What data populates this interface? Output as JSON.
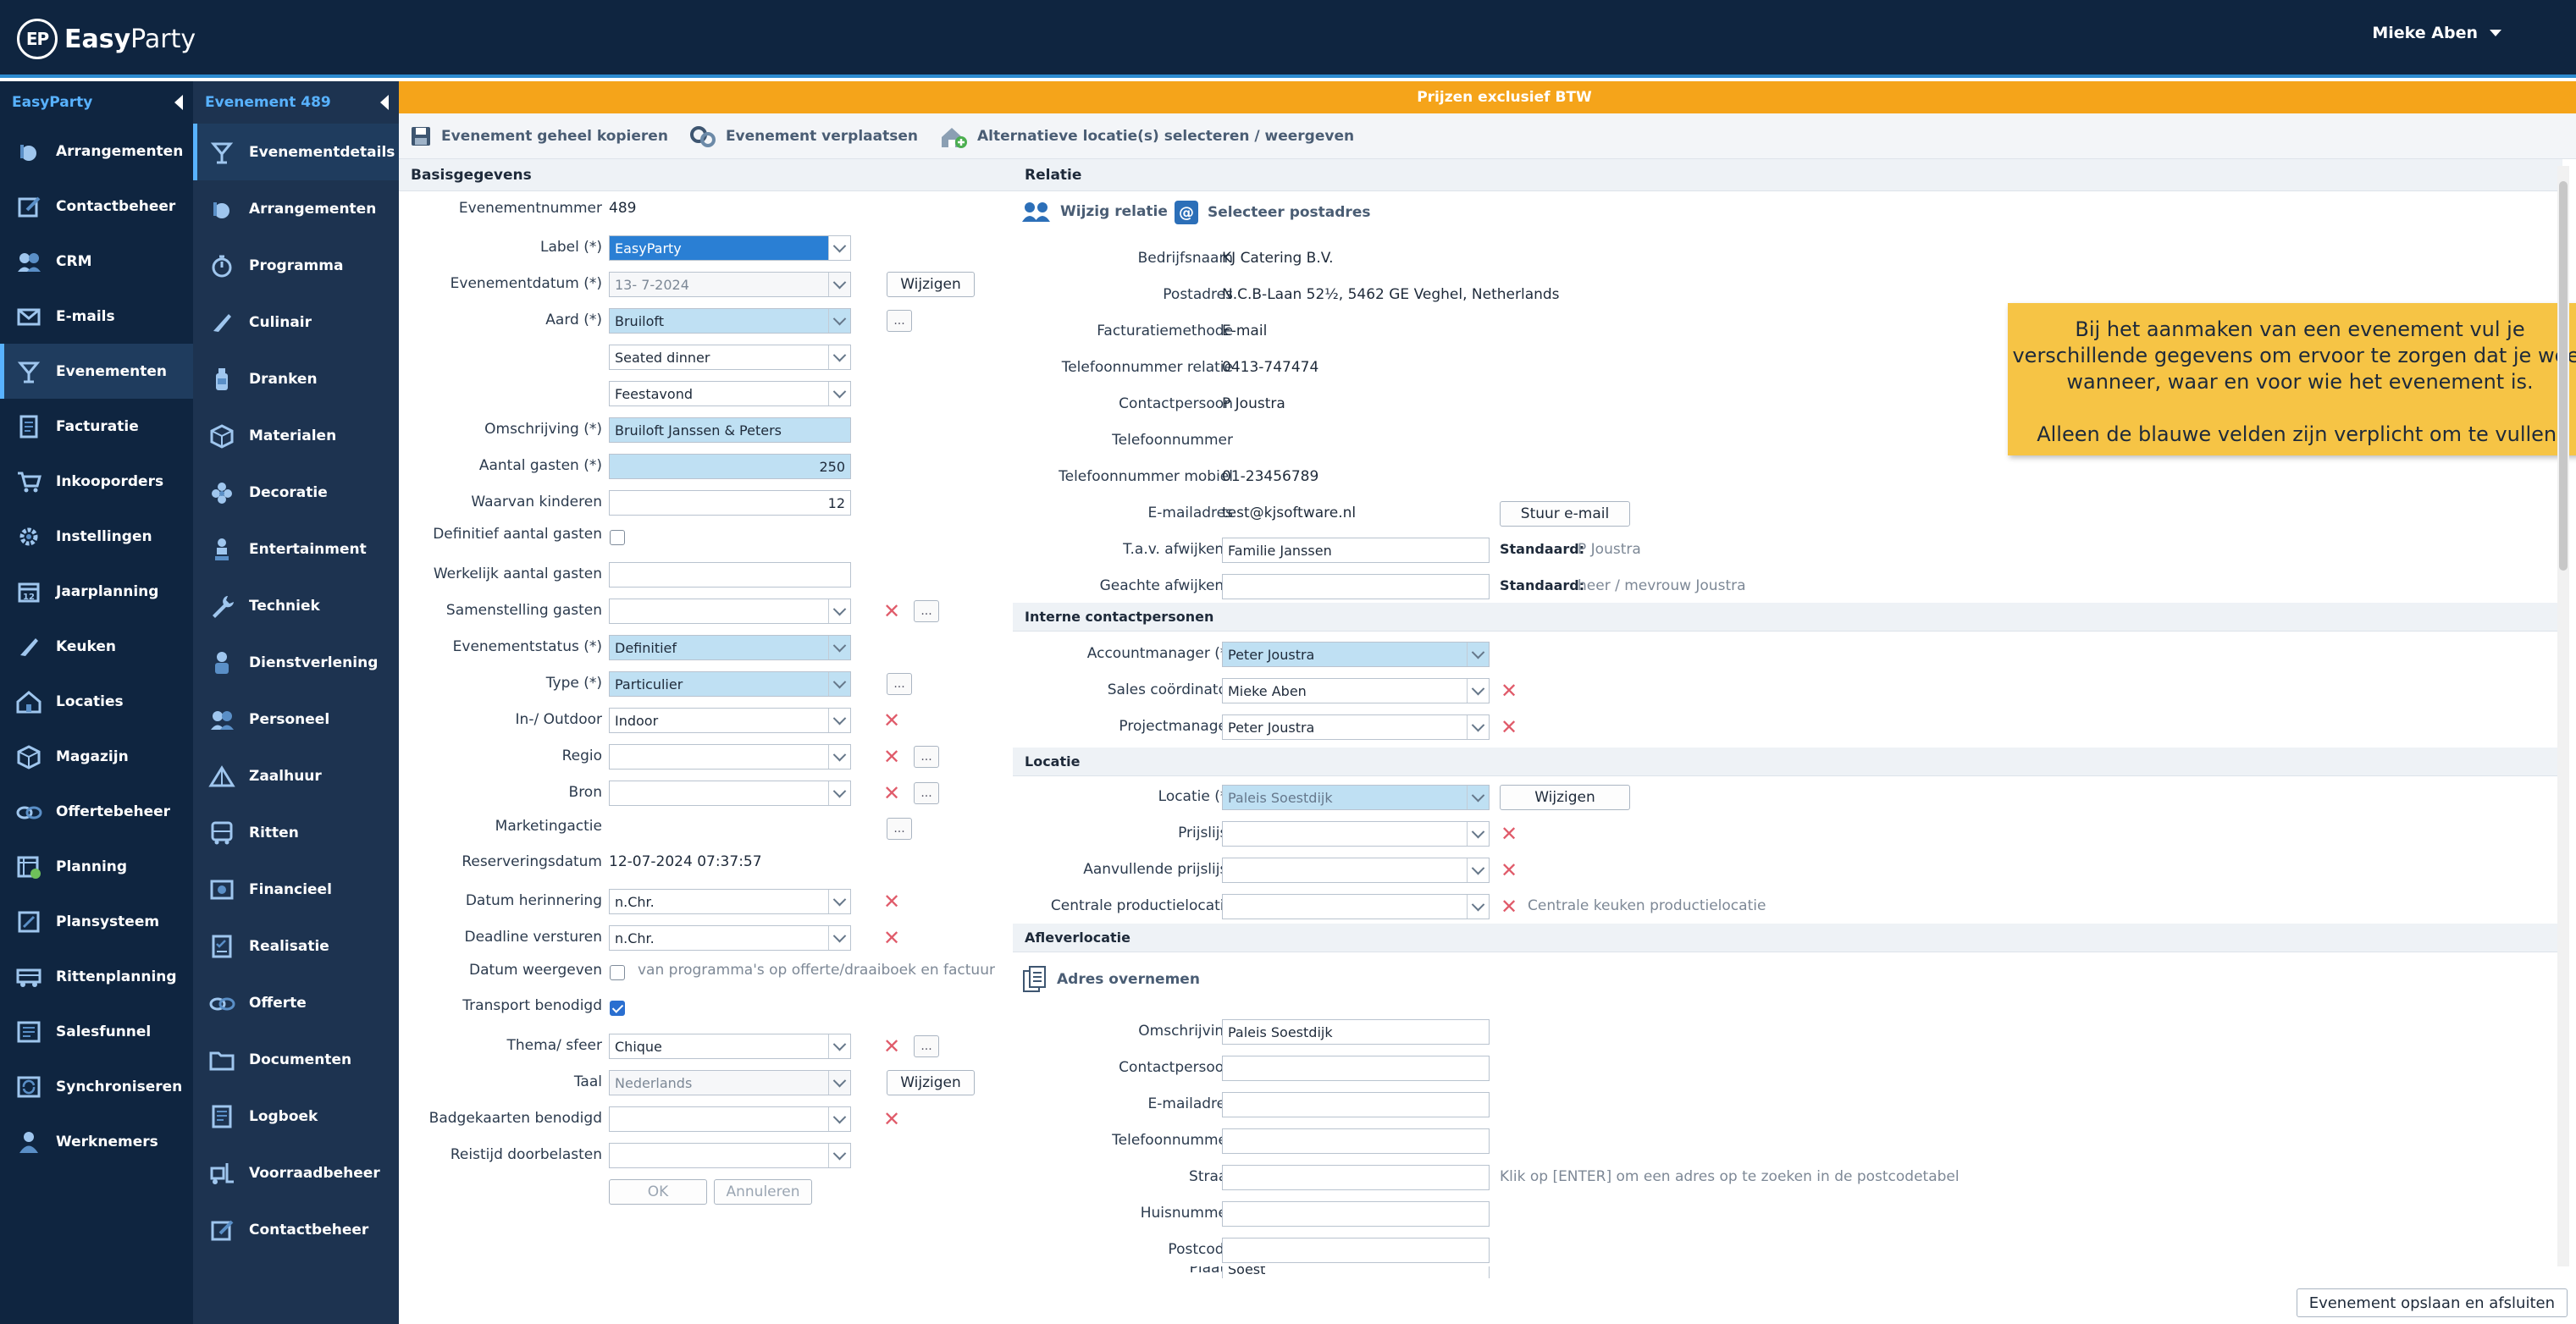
{
  "app": {
    "logo_badge": "EP",
    "logo_bold": "Easy",
    "logo_rest": "Party",
    "user_name": "Mieke Aben"
  },
  "sidebar": {
    "title": "EasyParty",
    "items": [
      {
        "label": "Arrangementen",
        "icon": "dishes-icon"
      },
      {
        "label": "Contactbeheer",
        "icon": "edit-icon"
      },
      {
        "label": "CRM",
        "icon": "people-icon"
      },
      {
        "label": "E-mails",
        "icon": "mail-icon"
      },
      {
        "label": "Evenementen",
        "icon": "cocktail-icon"
      },
      {
        "label": "Facturatie",
        "icon": "invoice-icon"
      },
      {
        "label": "Inkooporders",
        "icon": "cart-icon"
      },
      {
        "label": "Instellingen",
        "icon": "gear-icon"
      },
      {
        "label": "Jaarplanning",
        "icon": "calendar-icon"
      },
      {
        "label": "Keuken",
        "icon": "knife-icon"
      },
      {
        "label": "Locaties",
        "icon": "house-icon"
      },
      {
        "label": "Magazijn",
        "icon": "box-icon"
      },
      {
        "label": "Offertebeheer",
        "icon": "offer-icon"
      },
      {
        "label": "Planning",
        "icon": "planning-icon"
      },
      {
        "label": "Plansysteem",
        "icon": "plan-icon"
      },
      {
        "label": "Rittenplanning",
        "icon": "truck-icon"
      },
      {
        "label": "Salesfunnel",
        "icon": "funnel-icon"
      },
      {
        "label": "Synchroniseren",
        "icon": "sync-icon"
      },
      {
        "label": "Werknemers",
        "icon": "employee-icon"
      }
    ]
  },
  "subnav": {
    "title": "Evenement 489",
    "items": [
      {
        "label": "Evenementdetails",
        "icon": "cocktail-icon"
      },
      {
        "label": "Arrangementen",
        "icon": "dishes-icon"
      },
      {
        "label": "Programma",
        "icon": "stopwatch-icon"
      },
      {
        "label": "Culinair",
        "icon": "knife-icon"
      },
      {
        "label": "Dranken",
        "icon": "bottle-icon"
      },
      {
        "label": "Materialen",
        "icon": "box-icon"
      },
      {
        "label": "Decoratie",
        "icon": "flower-icon"
      },
      {
        "label": "Entertainment",
        "icon": "performer-icon"
      },
      {
        "label": "Techniek",
        "icon": "wrench-icon"
      },
      {
        "label": "Dienstverlening",
        "icon": "service-icon"
      },
      {
        "label": "Personeel",
        "icon": "people-icon"
      },
      {
        "label": "Zaalhuur",
        "icon": "tent-icon"
      },
      {
        "label": "Ritten",
        "icon": "bus-icon"
      },
      {
        "label": "Financieel",
        "icon": "finance-icon"
      },
      {
        "label": "Realisatie",
        "icon": "checklist-icon"
      },
      {
        "label": "Offerte",
        "icon": "offer-icon"
      },
      {
        "label": "Documenten",
        "icon": "folder-icon"
      },
      {
        "label": "Logboek",
        "icon": "logbook-icon"
      },
      {
        "label": "Voorraadbeheer",
        "icon": "forklift-icon"
      },
      {
        "label": "Contactbeheer",
        "icon": "edit-icon"
      }
    ]
  },
  "banner": "Prijzen exclusief BTW",
  "toolbar": {
    "copy": "Evenement geheel kopieren",
    "move": "Evenement verplaatsen",
    "alt_location": "Alternatieve locatie(s) selecteren / weergeven"
  },
  "basis": {
    "header": "Basisgegevens",
    "evenementnummer_label": "Evenementnummer",
    "evenementnummer": "489",
    "label_label": "Label (*)",
    "label_value": "EasyParty",
    "datum_label": "Evenementdatum (*)",
    "datum_value": "13-  7-2024",
    "wijzigen": "Wijzigen",
    "aard_label": "Aard (*)",
    "aard_1": "Bruiloft",
    "aard_2": "Seated dinner",
    "aard_3": "Feestavond",
    "omschrijving_label": "Omschrijving (*)",
    "omschrijving": "Bruiloft Janssen & Peters",
    "aantal_label": "Aantal gasten (*)",
    "aantal": "250",
    "kinderen_label": "Waarvan kinderen",
    "kinderen": "12",
    "definitief_label": "Definitief aantal gasten",
    "werkelijk_label": "Werkelijk aantal gasten",
    "samenstelling_label": "Samenstelling gasten",
    "status_label": "Evenementstatus (*)",
    "status": "Definitief",
    "type_label": "Type (*)",
    "type": "Particulier",
    "inout_label": "In-/ Outdoor",
    "inout": "Indoor",
    "regio_label": "Regio",
    "bron_label": "Bron",
    "marketing_label": "Marketingactie",
    "reservering_label": "Reserveringsdatum",
    "reservering": "12-07-2024 07:37:57",
    "herinnering_label": "Datum herinnering",
    "herinnering": "n.Chr.",
    "deadline_label": "Deadline versturen",
    "deadline": "n.Chr.",
    "weergeven_label": "Datum weergeven",
    "weergeven_hint": "van programma's op offerte/draaiboek en factuur",
    "transport_label": "Transport benodigd",
    "thema_label": "Thema/ sfeer",
    "thema": "Chique",
    "taal_label": "Taal",
    "taal": "Nederlands",
    "badge_label": "Badgekaarten benodigd",
    "reistijd_label": "Reistijd doorbelasten",
    "ok": "OK",
    "annuleren": "Annuleren",
    "dots": "..."
  },
  "relatie": {
    "header": "Relatie",
    "wijzig": "Wijzig relatie",
    "selecteer": "Selecteer postadres",
    "bedrijfsnaam_label": "Bedrijfsnaam",
    "bedrijfsnaam": "KJ Catering B.V.",
    "postadres_label": "Postadres",
    "postadres": "N.C.B-Laan 52½, 5462 GE Veghel, Netherlands",
    "factuur_label": "Facturatiemethode",
    "factuur": "E-mail",
    "telrel_label": "Telefoonnummer relatie",
    "telrel": "0413-747474",
    "contact_label": "Contactpersoon",
    "contact": "P Joustra",
    "tel_label": "Telefoonnummer",
    "mobiel_label": "Telefoonnummer mobiel",
    "mobiel": "01-23456789",
    "email_label": "E-mailadres",
    "email": "test@kjsoftware.nl",
    "stuur": "Stuur e-mail",
    "tav_label": "T.a.v. afwijkend",
    "tav": "Familie Janssen",
    "standaard": "Standaard:",
    "tav_std": "P Joustra",
    "geachte_label": "Geachte afwijkend",
    "geachte_std": "heer / mevrouw Joustra"
  },
  "intern": {
    "header": "Interne contactpersonen",
    "am_label": "Accountmanager (*)",
    "am": "Peter Joustra",
    "sales_label": "Sales coördinator",
    "sales": "Mieke Aben",
    "pm_label": "Projectmanager",
    "pm": "Peter Joustra"
  },
  "locatie": {
    "header": "Locatie",
    "loc_label": "Locatie (*)",
    "loc": "Paleis Soestdijk",
    "wijzigen": "Wijzigen",
    "prijslijst_label": "Prijslijst",
    "aanv_label": "Aanvullende prijslijst",
    "centraal_label": "Centrale productielocatie",
    "centraal_hint": "Centrale keuken productielocatie"
  },
  "aflever": {
    "header": "Afleverlocatie",
    "adres": "Adres overnemen",
    "omschrijving_label": "Omschrijving",
    "omschrijving": "Paleis Soestdijk",
    "contact_label": "Contactpersoon",
    "email_label": "E-mailadres",
    "tel_label": "Telefoonnummer",
    "straat_label": "Straat",
    "straat_hint": "Klik op [ENTER] om een adres op te zoeken in de postcodetabel",
    "huisnr_label": "Huisnummer",
    "postcode_label": "Postcode",
    "plaats_label": "Plaats",
    "plaats": "Soest"
  },
  "callout": {
    "line1": "Bij het aanmaken van een evenement vul je verschillende gegevens om ervoor te zorgen dat je weet wanneer, waar en voor wie het evenement is.",
    "line2": "Alleen de blauwe velden zijn verplicht om te vullen."
  },
  "save_button": "Evenement opslaan en afsluiten",
  "colors": {
    "navy": "#0f2540",
    "subnav": "#1d3350",
    "accent": "#58b2ff",
    "orange": "#f5a41a",
    "required": "#bfe0f3",
    "callout": "#f6c445",
    "delete": "#e05b6a"
  }
}
